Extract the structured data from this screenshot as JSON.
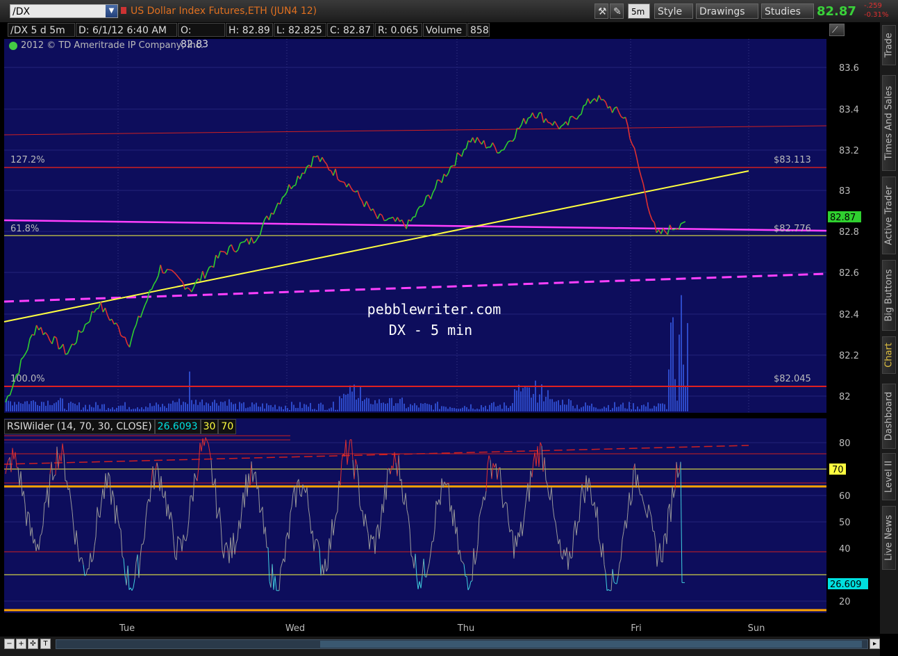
{
  "toolbar": {
    "symbol": "/DX",
    "instrument": "US Dollar Index Futures,ETH (JUN4 12)",
    "interval_btn": "5m",
    "style_btn": "Style",
    "drawings_btn": "Drawings",
    "studies_btn": "Studies",
    "last_price": "82.87",
    "change_abs": "-.259",
    "change_pct": "-0.31%"
  },
  "info_bar": {
    "symbol_period": "/DX 5 d 5m",
    "date": "D: 6/1/12 6:40 AM",
    "open": "O: 82.83",
    "high": "H: 82.89",
    "low": "L: 82.825",
    "close": "C: 82.87",
    "range": "R: 0.065",
    "volume_label": "Volume",
    "volume": "858"
  },
  "copyright": "2012 © TD Ameritrade IP Company, Inc.",
  "price_axis": [
    "83.6",
    "83.4",
    "83.2",
    "83",
    "82.8",
    "82.6",
    "82.4",
    "82.2",
    "82"
  ],
  "price_marker": "82.87",
  "levels": {
    "fib_1272": "127.2%",
    "fib_1272_price": "$83.113",
    "fib_618": "61.8%",
    "fib_618_price": "$82.776",
    "fib_100": "100.0%",
    "fib_100_price": "$82.045"
  },
  "watermark": {
    "line1": "pebblewriter.com",
    "line2": "DX - 5 min"
  },
  "rsi": {
    "name": "RSIWilder (14, 70, 30, CLOSE)",
    "value": "26.6093",
    "ob": "30",
    "os": "70",
    "axis": [
      "80",
      "70",
      "60",
      "50",
      "40",
      "30",
      "20"
    ],
    "marker_70": "70",
    "marker_val": "26.609"
  },
  "time_axis": [
    "Tue",
    "Wed",
    "Thu",
    "Fri",
    "Sun"
  ],
  "side_tabs": [
    "Trade",
    "Times And Sales",
    "Active Trader",
    "Big Buttons",
    "Chart",
    "Dashboard",
    "Level II",
    "Live News"
  ],
  "colors": {
    "panel_bg": "#0d0d5c",
    "up": "#2fd02f",
    "down": "#e03030",
    "trend": "#ffff40",
    "magenta": "#ff40ff",
    "level": "#e02020",
    "rsi": "#999999"
  },
  "chart_data": {
    "type": "line",
    "title": "/DX 5 d 5m",
    "x": [
      "Tue",
      "Wed",
      "Thu",
      "Fri"
    ],
    "ylim": [
      81.97,
      83.72
    ],
    "series": [
      {
        "name": "/DX",
        "values": [
          82.02,
          82.38,
          82.25,
          82.48,
          82.3,
          82.65,
          82.55,
          82.72,
          82.78,
          83.0,
          83.17,
          83.05,
          82.88,
          82.85,
          83.05,
          83.25,
          83.2,
          83.38,
          83.3,
          83.45,
          83.35,
          82.8,
          82.87
        ]
      }
    ]
  }
}
